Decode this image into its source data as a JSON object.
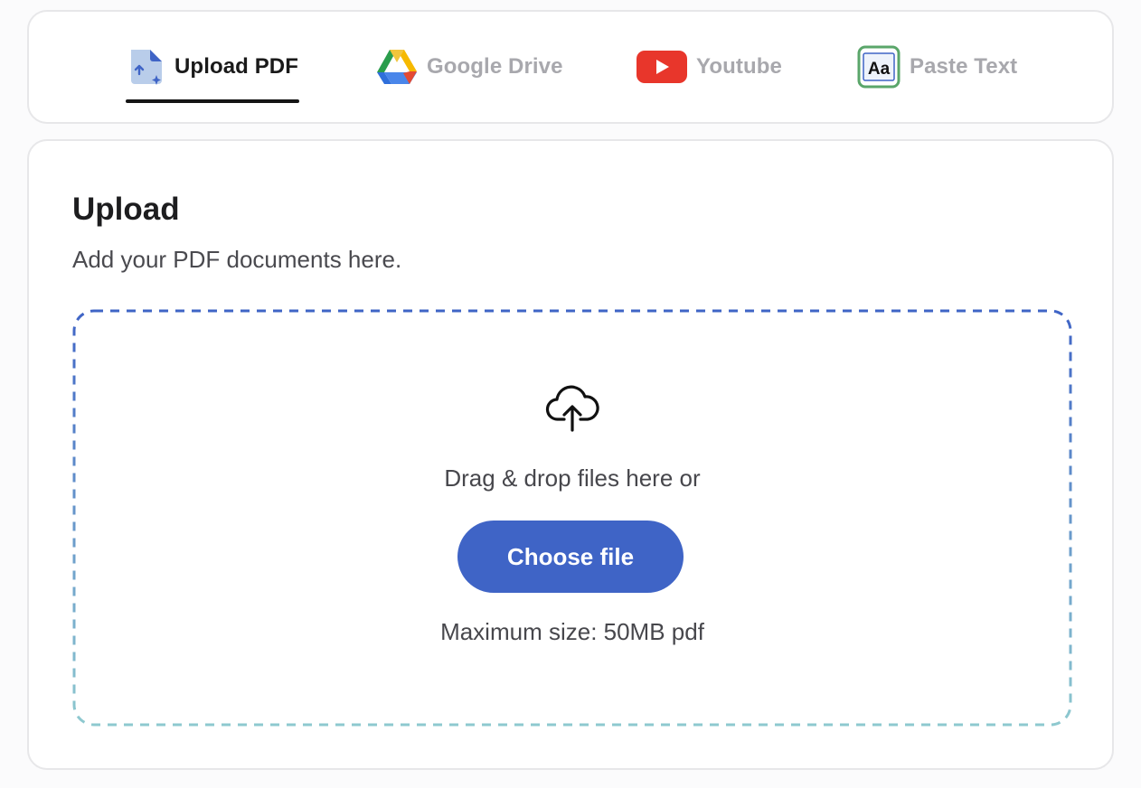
{
  "tabs": [
    {
      "label": "Upload PDF",
      "icon": "pdf-upload-icon",
      "active": true
    },
    {
      "label": "Google Drive",
      "icon": "google-drive-icon",
      "active": false
    },
    {
      "label": "Youtube",
      "icon": "youtube-icon",
      "active": false
    },
    {
      "label": "Paste Text",
      "icon": "paste-text-icon",
      "icon_text": "Aa",
      "active": false
    }
  ],
  "upload": {
    "title": "Upload",
    "subtitle": "Add your PDF documents here.",
    "drag_text": "Drag & drop files here or",
    "choose_button": "Choose file",
    "max_size": "Maximum size: 50MB pdf"
  },
  "colors": {
    "accent": "#3f64c6",
    "dashed_top": "#3f64c6",
    "dashed_bottom": "#8ec9cf",
    "youtube_red": "#e8362b",
    "paste_green": "#5aa66a"
  }
}
